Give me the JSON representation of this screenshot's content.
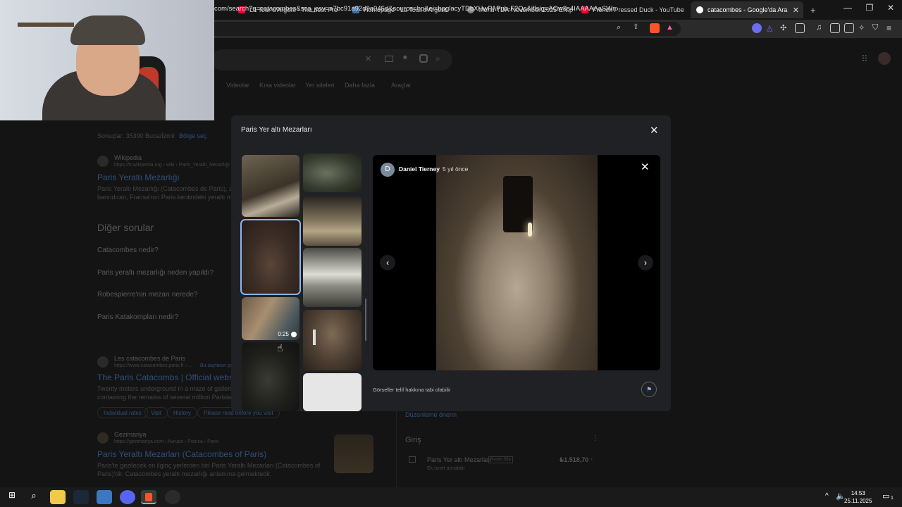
{
  "browser": {
    "tabs": [
      {
        "label": "La Tour d'Argent - The best Pressed"
      },
      {
        "label": "Homepage - La Tour d'Argent"
      },
      {
        "label": "Menu-TDA-November-2025-EN.pdf"
      },
      {
        "label": "French Pressed Duck - YouTube"
      },
      {
        "label": "catacombes - Google'da Ara"
      }
    ],
    "new_tab": "+",
    "url": "com/search?q=catacombes&sca_esv=a7bc91a92d9a045d&source=hp&ei=bpglacyTDbXHwPAPub-F2Qc&iflsig=AOw8s4IAAAAAaSWmf..."
  },
  "google": {
    "nav": [
      "Videolar",
      "Kısa videolar",
      "Yer siteleri",
      "Daha fazla",
      "Araçlar"
    ],
    "results_label": "Sonuçlar: 35390 Buca/İzmir",
    "change_location": "Bölge seç",
    "wiki": {
      "source": "Wikipedia",
      "url": "https://tr.wikipedia.org › wiki › Paris_Yeraltı_Mezarlığı",
      "title": "Paris Yeraltı Mezarlığı",
      "snippet1": "Paris Yeraltı Mezarlığı (Catacombes de Paris), altı",
      "snippet2": "barındıran, Fransa'nın Paris kentindeki yeraltı mez"
    },
    "other_q_title": "Diğer sorular",
    "questions": [
      "Catacombes nedir?",
      "Paris yeraltı mezarlığı neden yapıldı?",
      "Robespierre'nin mezarı nerede?",
      "Paris Katakompları nedir?"
    ],
    "site2": {
      "source": "Les catacombes de Paris",
      "url": "https://www.catacombes.paris.fr › ...",
      "tag": "Bu sayfanın çevirisini yap",
      "title": "The Paris Catacombs | Official webs",
      "snippet1": "Twenty meters underground in a maze of galleries,",
      "snippet2": "containing the remains of several million Parisians."
    },
    "chips": [
      "Individual rates",
      "Visit",
      "History",
      "Please read before you visit"
    ],
    "site3": {
      "source": "Gezimanya",
      "url": "https://gezimanya.com › Avrupa › Fransa › Paris",
      "title": "Paris Yeraltı Mezarları (Catacombes of Paris)",
      "snippet1": "Paris'te gezilecek en ilginç yerlerden biri Paris Yeraltı Mezarları (Catacombes of",
      "snippet2": "Paris)'dir. Catacombes yeraltı mezarlığı anlamına gelmektedir."
    },
    "kp": {
      "suggest_edit": "Düzenleme önerin",
      "entry_title": "Giriş",
      "entry_name": "Paris Yer altı Mezarları",
      "badge": "Resmi Site",
      "price": "₺1.518,70",
      "extra": "Ek ücret alınabilir"
    }
  },
  "modal": {
    "title": "Paris Yer altı Mezarları",
    "video_duration": "0:25",
    "viewer": {
      "avatar_letter": "D",
      "author": "Daniel Tierney",
      "time_ago": "5 yıl önce"
    },
    "copyright": "Görseller telif hakkına tabi olabilir"
  },
  "taskbar": {
    "time": "14:53",
    "date": "25.11.2025",
    "notification_count": "1"
  },
  "colors": {
    "accent_blue": "#8ab4f8",
    "modal_bg": "#202124",
    "youtube_red": "#ff0033"
  },
  "icons": {
    "lens": "google-lens-icon",
    "mic": "microphone-icon",
    "search": "search-icon",
    "close": "close-icon",
    "flag": "flag-icon"
  }
}
